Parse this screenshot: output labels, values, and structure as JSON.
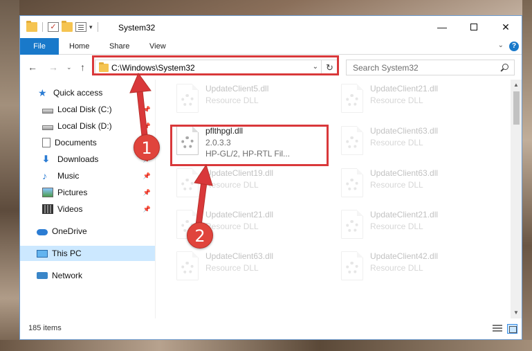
{
  "window": {
    "title": "System32",
    "minimize_glyph": "—",
    "close_glyph": "✕"
  },
  "qat": {
    "check_glyph": "✓",
    "dropdown_glyph": "▾"
  },
  "ribbon": {
    "tabs": [
      "File",
      "Home",
      "Share",
      "View"
    ],
    "expand_glyph": "⌄",
    "help_glyph": "?"
  },
  "nav": {
    "back_glyph": "←",
    "forward_glyph": "→",
    "recent_glyph": "⌄",
    "up_glyph": "↑"
  },
  "address": {
    "path": "C:\\Windows\\System32",
    "dropdown_glyph": "⌄",
    "refresh_glyph": "↻"
  },
  "search": {
    "placeholder": "Search System32"
  },
  "sidebar": {
    "pin_glyph": "📌",
    "items": [
      {
        "label": "Quick access",
        "icon": "star-icon"
      },
      {
        "label": "Local Disk (C:)",
        "icon": "disk-icon",
        "pinned": true
      },
      {
        "label": "Local Disk (D:)",
        "icon": "disk-icon",
        "pinned": true
      },
      {
        "label": "Documents",
        "icon": "documents-icon",
        "pinned": true
      },
      {
        "label": "Downloads",
        "icon": "download-icon",
        "pinned": true
      },
      {
        "label": "Music",
        "icon": "music-icon",
        "pinned": true
      },
      {
        "label": "Pictures",
        "icon": "pictures-icon",
        "pinned": true
      },
      {
        "label": "Videos",
        "icon": "videos-icon",
        "pinned": true
      },
      {
        "label": "OneDrive",
        "icon": "cloud-icon"
      },
      {
        "label": "This PC",
        "icon": "computer-icon",
        "selected": true
      },
      {
        "label": "Network",
        "icon": "network-icon"
      }
    ]
  },
  "files": {
    "left_column": [
      {
        "name": "UpdateClient5.dll",
        "line2": "Resource DLL"
      },
      {
        "name": "pflthpgl.dll",
        "line2": "2.0.3.3",
        "line3": "HP-GL/2, HP-RTL Fil...",
        "highlighted": true
      },
      {
        "name": "UpdateClient19.dll",
        "line2": "Resource DLL"
      },
      {
        "name": "UpdateClient21.dll",
        "line2": "Resource DLL"
      },
      {
        "name": "UpdateClient63.dll",
        "line2": "Resource DLL"
      }
    ],
    "right_column": [
      {
        "name": "UpdateClient21.dll",
        "line2": "Resource DLL"
      },
      {
        "name": "UpdateClient63.dll",
        "line2": "Resource DLL"
      },
      {
        "name": "UpdateClient63.dll",
        "line2": "Resource DLL"
      },
      {
        "name": "UpdateClient21.dll",
        "line2": "Resource DLL"
      },
      {
        "name": "UpdateClient42.dll",
        "line2": "Resource DLL"
      }
    ]
  },
  "scrollbar": {
    "up_glyph": "▲",
    "down_glyph": "▼"
  },
  "status": {
    "item_count": "185 items"
  },
  "annotations": {
    "badge_1": "1",
    "badge_2": "2",
    "color": "#d9383a"
  }
}
